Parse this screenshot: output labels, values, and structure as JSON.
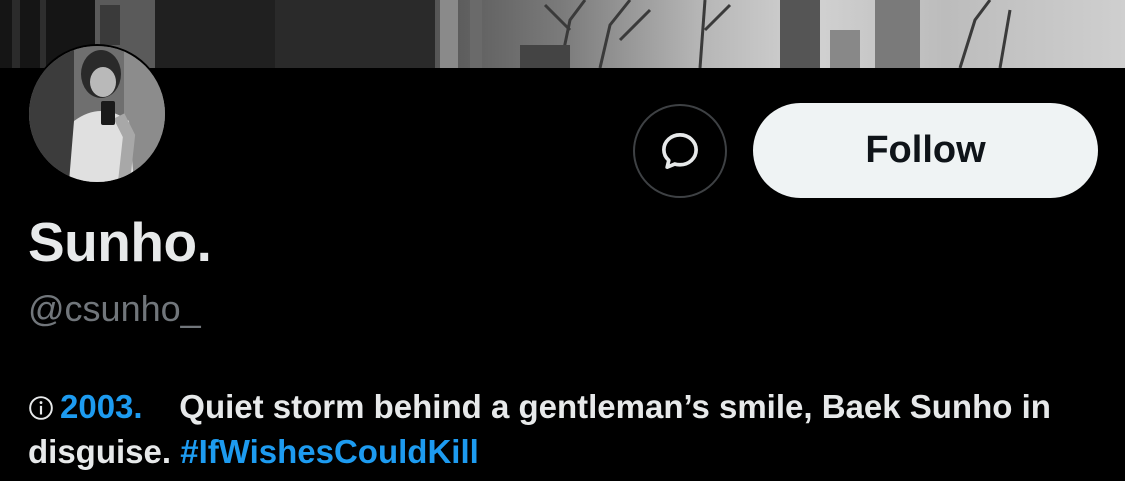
{
  "profile": {
    "display_name": "Sunho.",
    "handle": "@csunho_"
  },
  "actions": {
    "message_icon": "chat-bubble-icon",
    "follow_label": "Follow"
  },
  "bio": {
    "info_icon": "info-icon",
    "year": "2003.",
    "text": "Quiet storm behind a gentleman’s smile, Baek Sunho in disguise.",
    "hashtag": "#IfWishesCouldKill"
  },
  "colors": {
    "background": "#000000",
    "link": "#1d9bf0",
    "primary_text": "#e7e9ea",
    "secondary_text": "#71767b",
    "follow_bg": "#eff3f4"
  }
}
